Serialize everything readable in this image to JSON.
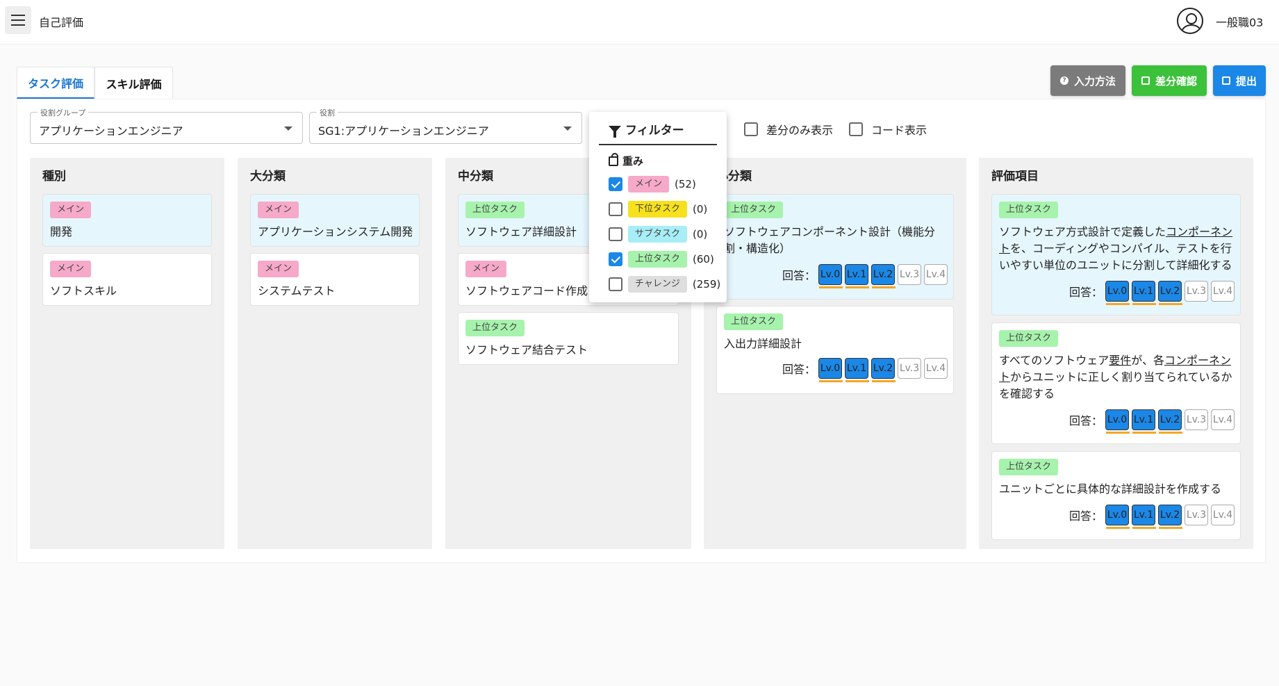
{
  "app": {
    "title": "自己評価",
    "user": "一般職03"
  },
  "tabs": [
    "タスク評価",
    "スキル評価"
  ],
  "actions": {
    "howto": "入力方法",
    "diff": "差分確認",
    "submit": "提出"
  },
  "selects": {
    "group": {
      "label": "役割グループ",
      "value": "アプリケーションエンジニア"
    },
    "role": {
      "label": "役割",
      "value": "SG1:アプリケーションエンジニア"
    }
  },
  "options": {
    "diff_only": "差分のみ表示",
    "code": "コード表示"
  },
  "columns": {
    "type": {
      "title": "種別",
      "cards": [
        {
          "tag": "メイン",
          "text": "開発"
        },
        {
          "tag": "メイン",
          "text": "ソフトスキル"
        }
      ]
    },
    "large": {
      "title": "大分類",
      "cards": [
        {
          "tag": "メイン",
          "text": "アプリケーションシステム開発"
        },
        {
          "tag": "メイン",
          "text": "システムテスト"
        }
      ]
    },
    "middle": {
      "title": "中分類",
      "cards": [
        {
          "tag": "上位タスク",
          "text": "ソフトウェア詳細設計"
        },
        {
          "tag": "メイン",
          "text": "ソフトウェアコード作成"
        },
        {
          "tag": "上位タスク",
          "text": "ソフトウェア結合テスト"
        }
      ]
    },
    "small": {
      "title": "小分類",
      "cards": [
        {
          "tag": "上位タスク",
          "text": "ソフトウェアコンポーネント設計（機能分割・構造化）"
        },
        {
          "tag": "上位タスク",
          "text": "入出力詳細設計"
        }
      ]
    },
    "items": {
      "title": "評価項目",
      "cards": [
        {
          "tag": "上位タスク",
          "pre": "ソフトウェア方式設計で定義した",
          "link": "コンポーネント",
          "post": "を、コーディングやコンパイル、テストを行いやすい単位のユニットに分割して詳細化する"
        },
        {
          "tag": "上位タスク",
          "pre": "すべてのソフトウェア",
          "link1": "要件",
          "mid": "が、各",
          "link2": "コンポーネント",
          "post": "からユニットに正しく割り当てられているかを確認する"
        },
        {
          "tag": "上位タスク",
          "text": "ユニットごとに具体的な詳細設計を作成する"
        }
      ]
    }
  },
  "answer_label": "回答：",
  "levels": [
    "Lv.0",
    "Lv.1",
    "Lv.2",
    "Lv.3",
    "Lv.4"
  ],
  "filter": {
    "title": "フィルター",
    "section": "重み",
    "rows": [
      {
        "tag": "メイン",
        "count": "(52)",
        "checked": true
      },
      {
        "tag": "下位タスク",
        "count": "(0)",
        "checked": false
      },
      {
        "tag": "サブタスク",
        "count": "(0)",
        "checked": false
      },
      {
        "tag": "上位タスク",
        "count": "(60)",
        "checked": true
      },
      {
        "tag": "チャレンジ",
        "count": "(259)",
        "checked": false
      }
    ]
  }
}
